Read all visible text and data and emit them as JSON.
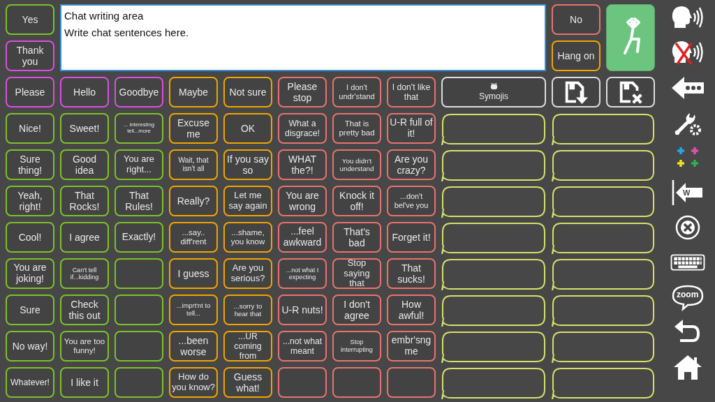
{
  "top": {
    "left": [
      {
        "label": "Yes",
        "color": "#7cc22a"
      },
      {
        "label": "Thank you",
        "color": "#d94fe0"
      }
    ],
    "chat_area": {
      "lines": [
        "Chat writing area",
        "Write chat sentences here."
      ]
    },
    "right": [
      {
        "label": "No",
        "color": "#e8736e"
      },
      {
        "label": "Hang on",
        "color": "#f0a500"
      }
    ]
  },
  "grid": [
    [
      {
        "kind": "phrase",
        "label": "Please",
        "color": "#d94fe0"
      },
      {
        "kind": "phrase",
        "label": "Hello",
        "color": "#d94fe0"
      },
      {
        "kind": "phrase",
        "label": "Goodbye",
        "color": "#d94fe0"
      },
      {
        "kind": "phrase",
        "label": "Maybe",
        "color": "#f0a500"
      },
      {
        "kind": "phrase",
        "label": "Not sure",
        "color": "#f0a500"
      },
      {
        "kind": "phrase",
        "label": "Please stop",
        "color": "#e8736e"
      },
      {
        "kind": "phrase",
        "label": "I don't undr'stand",
        "color": "#e8736e"
      },
      {
        "kind": "phrase",
        "label": "I don't like that",
        "color": "#e8736e"
      },
      {
        "kind": "symojis",
        "label": "Symojis",
        "color": "#dddddd"
      },
      {
        "kind": "save",
        "color": "#dddddd"
      },
      {
        "kind": "discard",
        "color": "#dddddd"
      }
    ],
    [
      {
        "kind": "phrase",
        "label": "Nice!",
        "color": "#7cc22a"
      },
      {
        "kind": "phrase",
        "label": "Sweet!",
        "color": "#7cc22a"
      },
      {
        "kind": "phrase",
        "label": "... interesting tell...more",
        "color": "#7cc22a"
      },
      {
        "kind": "phrase",
        "label": "Excuse me",
        "color": "#f0a500"
      },
      {
        "kind": "phrase",
        "label": "OK",
        "color": "#f0a500"
      },
      {
        "kind": "phrase",
        "label": "What a disgrace!",
        "color": "#e8736e"
      },
      {
        "kind": "phrase",
        "label": "That is pretty bad",
        "color": "#e8736e"
      },
      {
        "kind": "phrase",
        "label": "U-R full of it!",
        "color": "#e8736e"
      },
      {
        "kind": "bubble",
        "color": "#d4e26a"
      },
      {
        "kind": "bubble",
        "color": "#d4e26a"
      }
    ],
    [
      {
        "kind": "phrase",
        "label": "Sure thing!",
        "color": "#7cc22a"
      },
      {
        "kind": "phrase",
        "label": "Good idea",
        "color": "#7cc22a"
      },
      {
        "kind": "phrase",
        "label": "You are right...",
        "color": "#7cc22a"
      },
      {
        "kind": "phrase",
        "label": "Wait, that isn't all",
        "color": "#f0a500"
      },
      {
        "kind": "phrase",
        "label": "If you say so",
        "color": "#f0a500"
      },
      {
        "kind": "phrase",
        "label": "WHAT the?!",
        "color": "#e8736e"
      },
      {
        "kind": "phrase",
        "label": "You didn't understand",
        "color": "#e8736e"
      },
      {
        "kind": "phrase",
        "label": "Are you crazy?",
        "color": "#e8736e"
      },
      {
        "kind": "bubble",
        "color": "#d4e26a"
      },
      {
        "kind": "bubble",
        "color": "#d4e26a"
      }
    ],
    [
      {
        "kind": "phrase",
        "label": "Yeah, right!",
        "color": "#7cc22a"
      },
      {
        "kind": "phrase",
        "label": "That Rocks!",
        "color": "#7cc22a"
      },
      {
        "kind": "phrase",
        "label": "That Rules!",
        "color": "#7cc22a"
      },
      {
        "kind": "phrase",
        "label": "Really?",
        "color": "#f0a500"
      },
      {
        "kind": "phrase",
        "label": "Let me say again",
        "color": "#f0a500"
      },
      {
        "kind": "phrase",
        "label": "You are wrong",
        "color": "#e8736e"
      },
      {
        "kind": "phrase",
        "label": "Knock it off!",
        "color": "#e8736e"
      },
      {
        "kind": "phrase",
        "label": "...don't bel've you",
        "color": "#e8736e"
      },
      {
        "kind": "bubble",
        "color": "#d4e26a"
      },
      {
        "kind": "bubble",
        "color": "#d4e26a"
      }
    ],
    [
      {
        "kind": "phrase",
        "label": "Cool!",
        "color": "#7cc22a"
      },
      {
        "kind": "phrase",
        "label": "I agree",
        "color": "#7cc22a"
      },
      {
        "kind": "phrase",
        "label": "Exactly!",
        "color": "#7cc22a"
      },
      {
        "kind": "phrase",
        "label": "...say.. diff'rent",
        "color": "#f0a500"
      },
      {
        "kind": "phrase",
        "label": "...shame, you know",
        "color": "#f0a500"
      },
      {
        "kind": "phrase",
        "label": "...feel awkward",
        "color": "#e8736e"
      },
      {
        "kind": "phrase",
        "label": "That's bad",
        "color": "#e8736e"
      },
      {
        "kind": "phrase",
        "label": "Forget it!",
        "color": "#e8736e"
      },
      {
        "kind": "bubble",
        "color": "#d4e26a"
      },
      {
        "kind": "bubble",
        "color": "#d4e26a"
      }
    ],
    [
      {
        "kind": "phrase",
        "label": "You are joking!",
        "color": "#7cc22a"
      },
      {
        "kind": "phrase",
        "label": "Can't tell if...kidding",
        "color": "#7cc22a"
      },
      {
        "kind": "phrase",
        "color": "#7cc22a"
      },
      {
        "kind": "phrase",
        "label": "I guess",
        "color": "#f0a500"
      },
      {
        "kind": "phrase",
        "label": "Are you serious?",
        "color": "#f0a500"
      },
      {
        "kind": "phrase",
        "label": "...not what I expecting",
        "color": "#e8736e"
      },
      {
        "kind": "phrase",
        "label": "Stop saying that",
        "color": "#e8736e"
      },
      {
        "kind": "phrase",
        "label": "That sucks!",
        "color": "#e8736e"
      },
      {
        "kind": "bubble",
        "color": "#d4e26a"
      },
      {
        "kind": "bubble",
        "color": "#d4e26a"
      }
    ],
    [
      {
        "kind": "phrase",
        "label": "Sure",
        "color": "#7cc22a"
      },
      {
        "kind": "phrase",
        "label": "Check this out",
        "color": "#7cc22a"
      },
      {
        "kind": "phrase",
        "color": "#7cc22a"
      },
      {
        "kind": "phrase",
        "label": "...imprt'nt to tell...",
        "color": "#f0a500"
      },
      {
        "kind": "phrase",
        "label": "...sorry to hear that",
        "color": "#f0a500"
      },
      {
        "kind": "phrase",
        "label": "U-R nuts!",
        "color": "#e8736e"
      },
      {
        "kind": "phrase",
        "label": "I don't agree",
        "color": "#e8736e"
      },
      {
        "kind": "phrase",
        "label": "How awful!",
        "color": "#e8736e"
      },
      {
        "kind": "bubble",
        "color": "#d4e26a"
      },
      {
        "kind": "bubble",
        "color": "#d4e26a"
      }
    ],
    [
      {
        "kind": "phrase",
        "label": "No way!",
        "color": "#7cc22a"
      },
      {
        "kind": "phrase",
        "label": "You are too funny!",
        "color": "#7cc22a"
      },
      {
        "kind": "phrase",
        "color": "#7cc22a"
      },
      {
        "kind": "phrase",
        "label": "...been worse",
        "color": "#f0a500"
      },
      {
        "kind": "phrase",
        "label": "...UR coming from",
        "color": "#f0a500"
      },
      {
        "kind": "phrase",
        "label": "...not what meant",
        "color": "#e8736e"
      },
      {
        "kind": "phrase",
        "label": "Stop interrupting",
        "color": "#e8736e"
      },
      {
        "kind": "phrase",
        "label": "embr'sng me",
        "color": "#e8736e"
      },
      {
        "kind": "bubble",
        "color": "#d4e26a"
      },
      {
        "kind": "bubble",
        "color": "#d4e26a"
      }
    ],
    [
      {
        "kind": "phrase",
        "label": "Whatever!",
        "color": "#7cc22a"
      },
      {
        "kind": "phrase",
        "label": "I like it",
        "color": "#7cc22a"
      },
      {
        "kind": "phrase",
        "color": "#7cc22a"
      },
      {
        "kind": "phrase",
        "label": "How do you know?",
        "color": "#f0a500"
      },
      {
        "kind": "phrase",
        "label": "Guess what!",
        "color": "#f0a500"
      },
      {
        "kind": "phrase",
        "color": "#e8736e"
      },
      {
        "kind": "phrase",
        "color": "#e8736e"
      },
      {
        "kind": "phrase",
        "color": "#e8736e"
      },
      {
        "kind": "bubble",
        "color": "#d4e26a"
      },
      {
        "kind": "bubble",
        "color": "#d4e26a"
      }
    ]
  ],
  "sidebar": [
    {
      "kind": "speak"
    },
    {
      "kind": "mute"
    },
    {
      "kind": "backspace"
    },
    {
      "kind": "settings"
    },
    {
      "kind": "colors"
    },
    {
      "kind": "word-back",
      "label": "W"
    },
    {
      "kind": "clear"
    },
    {
      "kind": "keyboard"
    },
    {
      "kind": "zoom",
      "label": "zoom"
    },
    {
      "kind": "undo"
    },
    {
      "kind": "home"
    }
  ]
}
